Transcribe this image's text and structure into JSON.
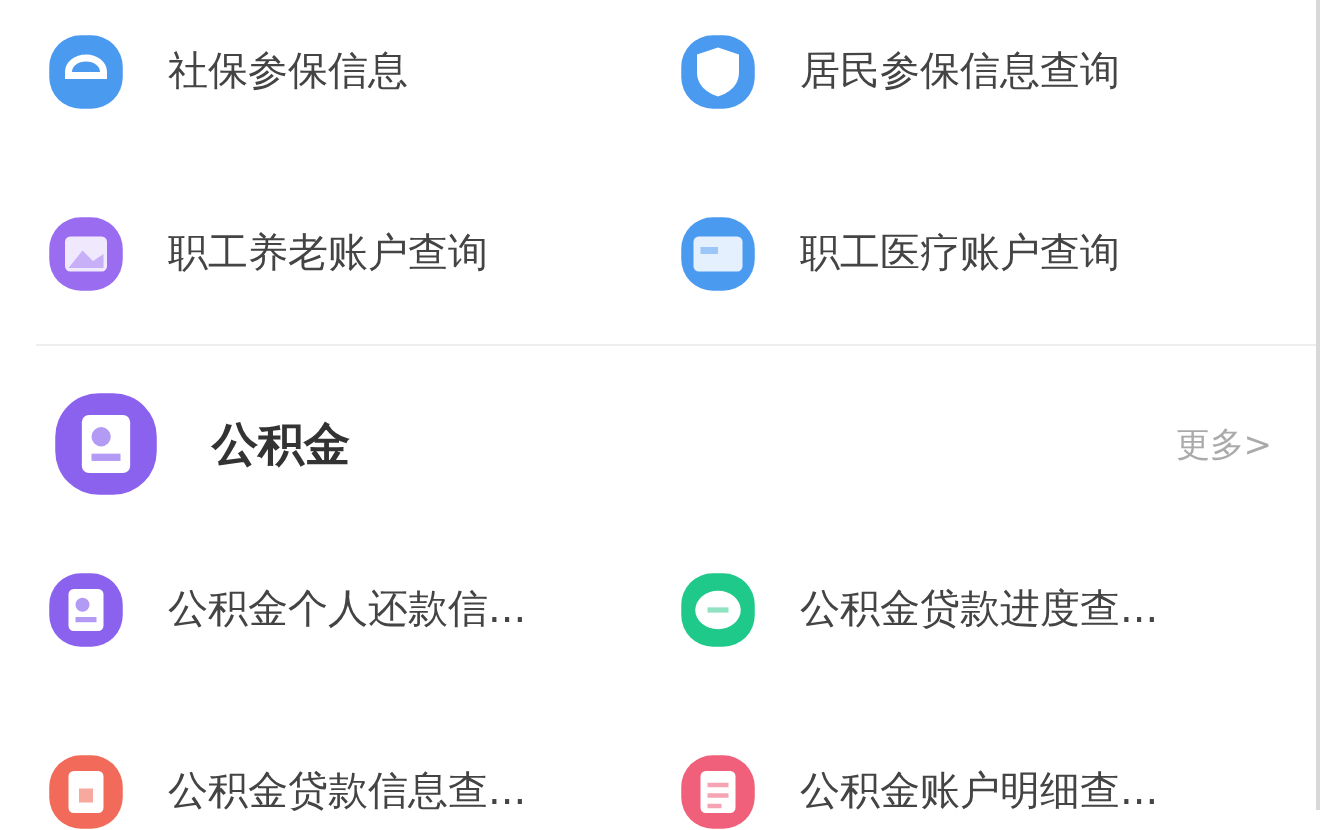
{
  "social_items": [
    {
      "label": "社保参保信息",
      "kind": "swirl",
      "color": "#4a9af0"
    },
    {
      "label": "居民参保信息查询",
      "kind": "shield",
      "color": "#4a9af0"
    },
    {
      "label": "职工养老账户查询",
      "kind": "photo",
      "color": "#9a6cf0"
    },
    {
      "label": "职工医疗账户查询",
      "kind": "card",
      "color": "#4a9af0"
    }
  ],
  "section": {
    "title": "公积金",
    "more": "更多>",
    "kind": "doc",
    "color": "#8a62ee"
  },
  "fund_items": [
    {
      "label": "公积金个人还款信...",
      "kind": "doc",
      "color": "#8a62ee"
    },
    {
      "label": "公积金贷款进度查...",
      "kind": "bubble",
      "color": "#1fc98a"
    },
    {
      "label": "公积金贷款信息查...",
      "kind": "clip",
      "color": "#f26a5a"
    },
    {
      "label": "公积金账户明细查...",
      "kind": "list",
      "color": "#f0607a"
    }
  ]
}
